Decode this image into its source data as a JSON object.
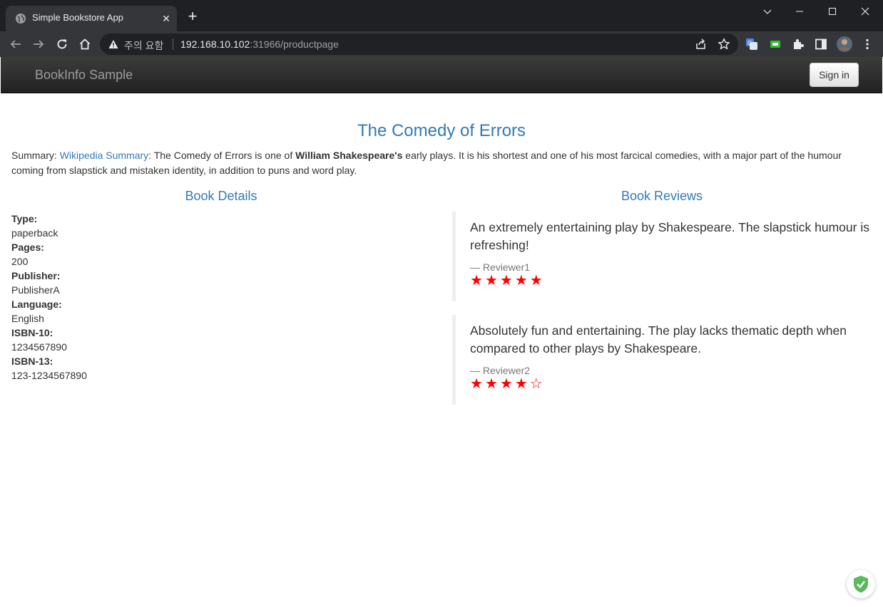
{
  "browser": {
    "tab_title": "Simple Bookstore App",
    "security_label": "주의 요함",
    "url_host": "192.168.10.102",
    "url_rest": ":31966/productpage"
  },
  "navbar": {
    "brand": "BookInfo Sample",
    "sign_in": "Sign in"
  },
  "product": {
    "title": "The Comedy of Errors",
    "summary_label": "Summary:",
    "summary_link": "Wikipedia Summary",
    "summary_pre": ": The Comedy of Errors is one of ",
    "summary_bold": "William Shakespeare's",
    "summary_post": " early plays. It is his shortest and one of his most farcical comedies, with a major part of the humour coming from slapstick and mistaken identity, in addition to puns and word play."
  },
  "details": {
    "heading": "Book Details",
    "items": [
      {
        "label": "Type:",
        "value": "paperback"
      },
      {
        "label": "Pages:",
        "value": "200"
      },
      {
        "label": "Publisher:",
        "value": "PublisherA"
      },
      {
        "label": "Language:",
        "value": "English"
      },
      {
        "label": "ISBN-10:",
        "value": "1234567890"
      },
      {
        "label": "ISBN-13:",
        "value": "123-1234567890"
      }
    ]
  },
  "reviews": {
    "heading": "Book Reviews",
    "items": [
      {
        "text": "An extremely entertaining play by Shakespeare. The slapstick humour is refreshing!",
        "reviewer": "— Reviewer1",
        "rating": 5,
        "max": 5
      },
      {
        "text": "Absolutely fun and entertaining. The play lacks thematic depth when compared to other plays by Shakespeare.",
        "reviewer": "— Reviewer2",
        "rating": 4,
        "max": 5
      }
    ],
    "star_color": "#ff0000"
  },
  "colors": {
    "link": "#337ab7",
    "navbar": "#222222",
    "chrome_frame": "#1f2023",
    "chrome_toolbar": "#35363a"
  },
  "icons": {
    "favicon": "globe-icon",
    "extension_shield": "shield-check-icon"
  }
}
